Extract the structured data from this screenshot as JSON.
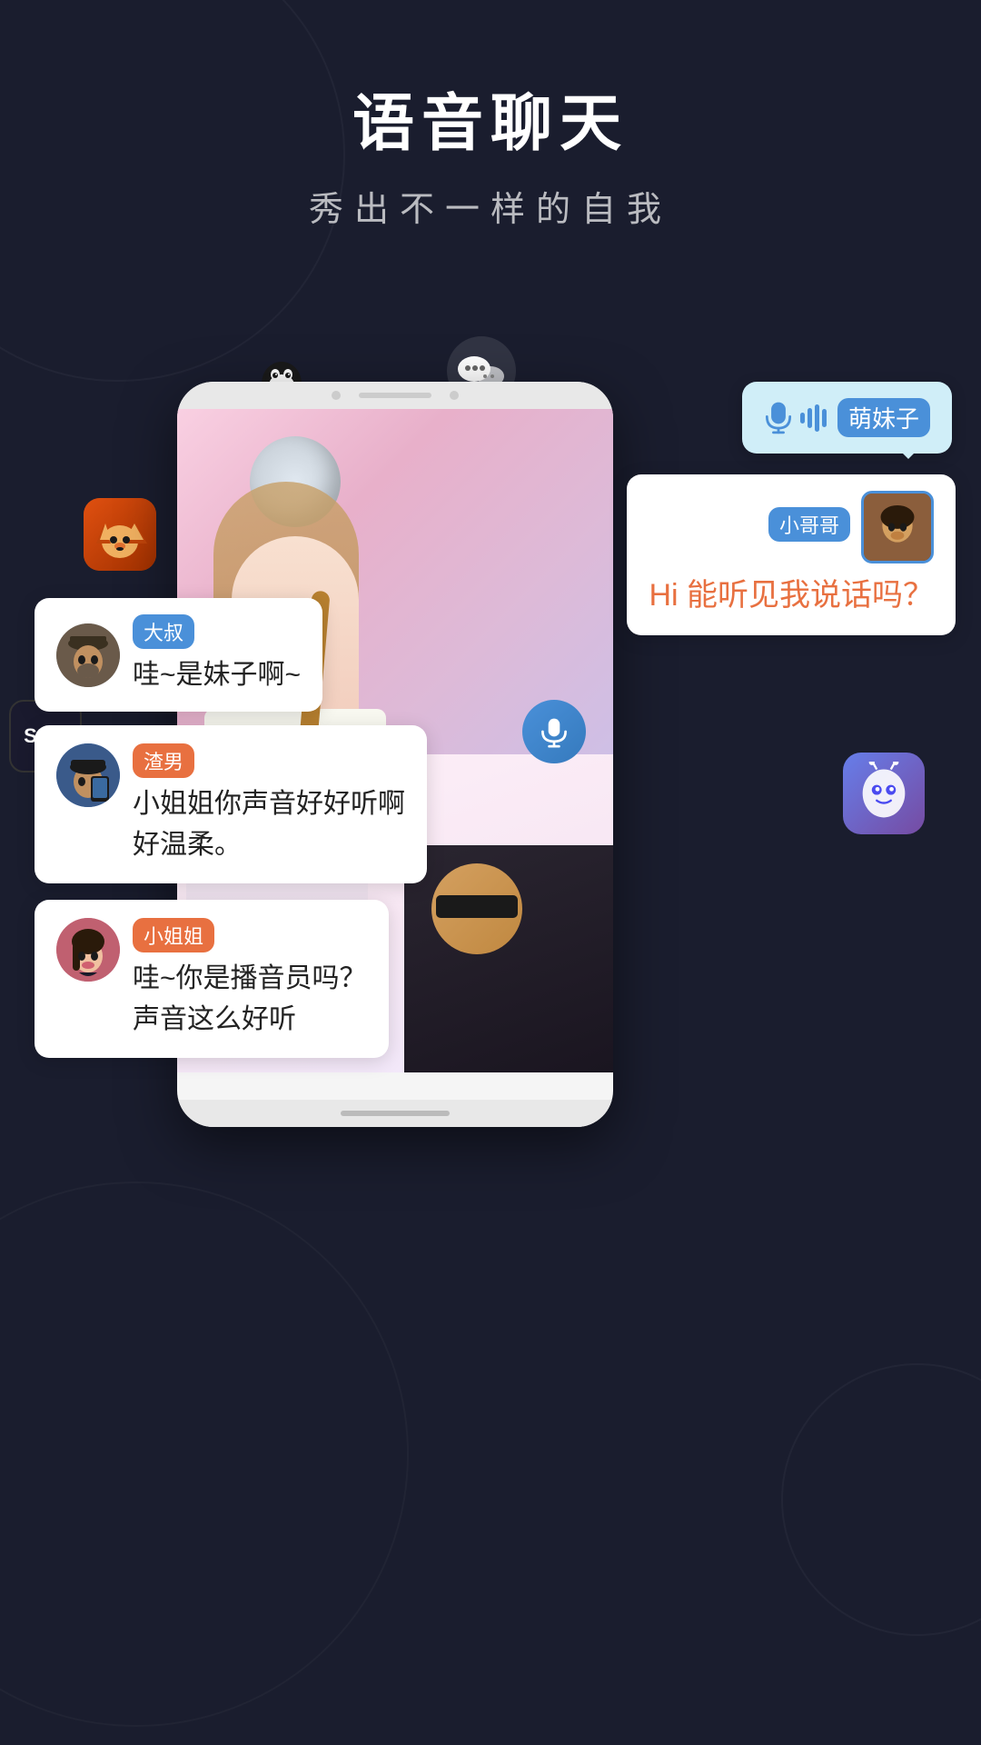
{
  "page": {
    "background_color": "#1a1d2e"
  },
  "header": {
    "main_title": "语音聊天",
    "sub_title": "秀出不一样的自我"
  },
  "app_icons": {
    "qq": {
      "label": "QQ",
      "emoji": "🐧"
    },
    "wechat": {
      "label": "微信"
    },
    "fox": {
      "label": "松鼠"
    },
    "soul": {
      "label": "Soul"
    },
    "faceu": {
      "label": "Faceu"
    }
  },
  "phone_mockup": {
    "mic_button": "🎤"
  },
  "bubbles": {
    "mengmeizi": {
      "tag": "萌妹子",
      "tag_color": "#4a90d9",
      "has_mic": true,
      "has_waves": true
    },
    "xiaogg": {
      "tag": "小哥哥",
      "tag_color": "#4a90d9",
      "message": "Hi 能听见我说话吗？",
      "message_color": "#e87040"
    },
    "dashu": {
      "tag": "大叔",
      "tag_color": "#4a90d9",
      "message": "哇~是妹子啊~"
    },
    "zhenan": {
      "tag": "渣男",
      "tag_color": "#e87040",
      "message": "小姐姐你声音好好听啊\n好温柔。"
    },
    "xiaojj": {
      "tag": "小姐姐",
      "tag_color": "#e87040",
      "message": "哇~你是播音员吗？\n声音这么好听"
    }
  }
}
